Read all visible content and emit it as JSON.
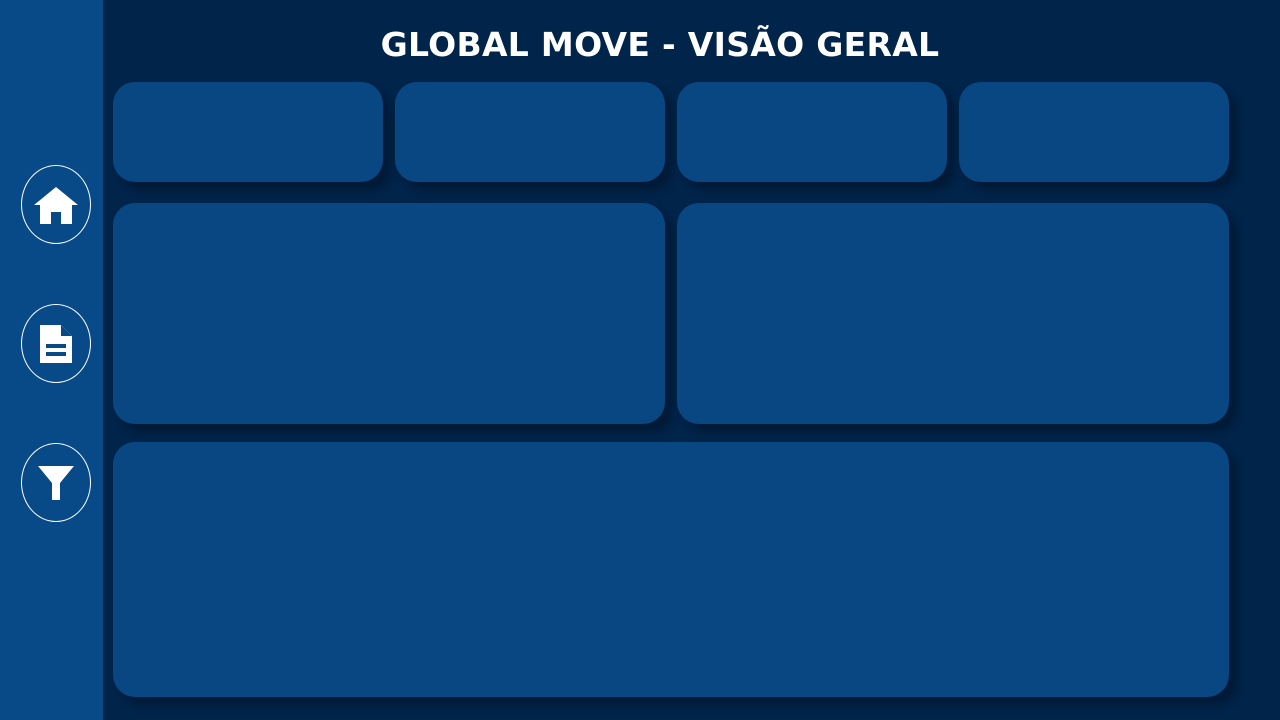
{
  "header": {
    "title": "GLOBAL MOVE - VISÃO GERAL"
  },
  "sidebar": {
    "items": [
      {
        "icon": "home-icon"
      },
      {
        "icon": "document-icon"
      },
      {
        "icon": "filter-icon"
      }
    ]
  },
  "colors": {
    "background": "#00244a",
    "sidebar": "#084a88",
    "card": "#094783",
    "text": "#ffffff"
  }
}
